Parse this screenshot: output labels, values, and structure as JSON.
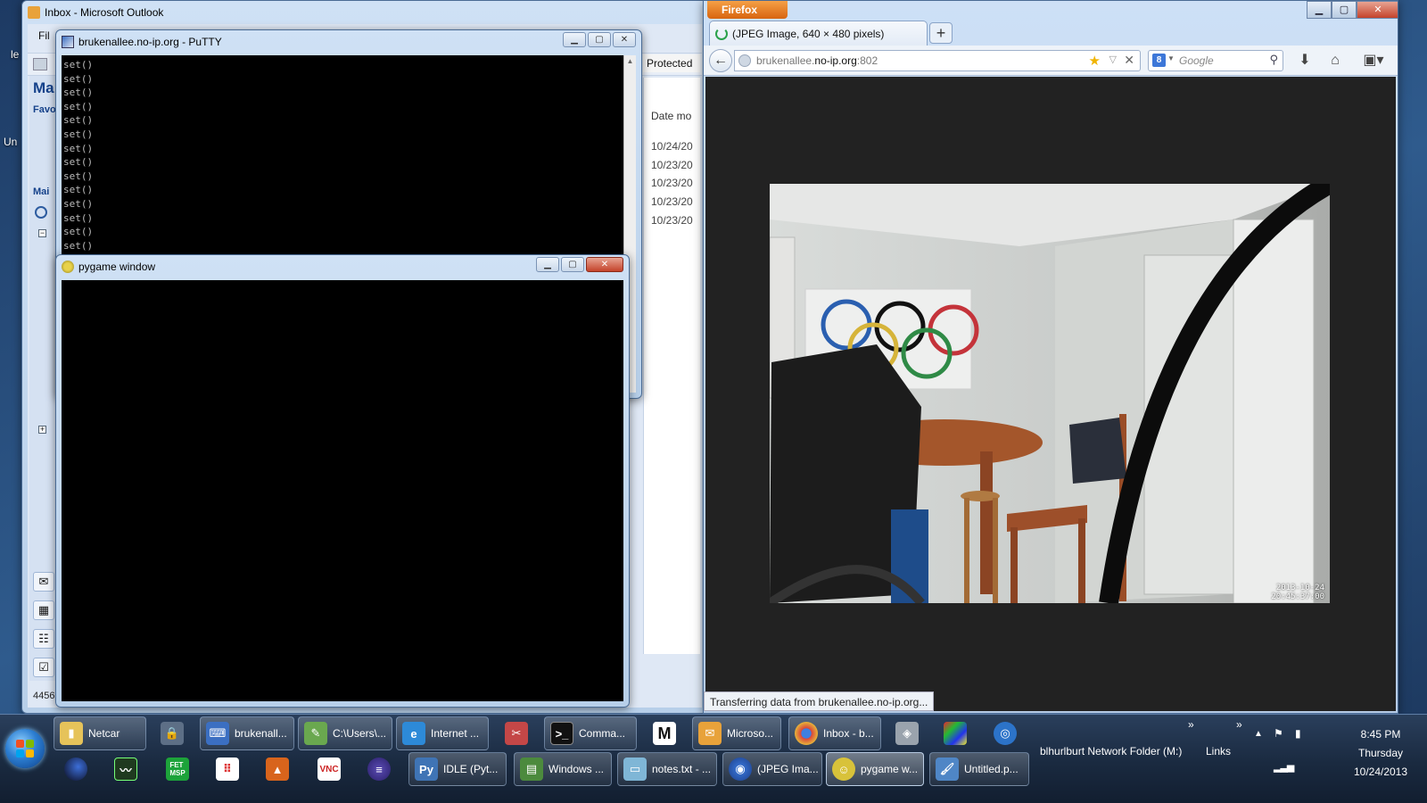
{
  "desktop": {
    "label_left_1": "le",
    "label_left_2": "Un"
  },
  "outlook": {
    "title": "Inbox - Microsoft Outlook",
    "menu_file": "Fil",
    "nav_title": "Ma",
    "favorites_label": "Favo",
    "mail_label": "Mai",
    "protected_label": "Protected",
    "date_header": "Date mo",
    "dates": [
      "10/24/20",
      "10/23/20",
      "10/23/20",
      "10/23/20",
      "10/23/20"
    ],
    "status": "4456 I"
  },
  "putty": {
    "title": "brukenallee.no-ip.org - PuTTY",
    "lines": [
      "set()",
      "set()",
      "set()",
      "set()",
      "set()",
      "set()",
      "set()",
      "set()",
      "set()",
      "set()",
      "set()",
      "set()",
      "set()",
      "set()"
    ]
  },
  "pygame": {
    "title": "pygame window"
  },
  "firefox": {
    "app_button": "Firefox",
    "tab_title": "(JPEG Image, 640 × 480 pixels)",
    "url_host": "brukenallee.",
    "url_domain": "no-ip.org",
    "url_port": ":802",
    "search_placeholder": "Google",
    "status_text": "Transferring data from brukenallee.no-ip.org...",
    "image_timestamp_date": "2013-10-24",
    "image_timestamp_time": "20:45:37:00"
  },
  "taskbar": {
    "row1": [
      {
        "label": "Netcar",
        "icon": "folder-icon",
        "color": "#e6c35a"
      },
      {
        "label": "brukenall...",
        "icon": "putty-icon",
        "color": "#3b6fc2"
      },
      {
        "label": "C:\\Users\\...",
        "icon": "notepad-chart-icon",
        "color": "#6aa84f"
      },
      {
        "label": "Internet ...",
        "icon": "internet-explorer-icon",
        "color": "#2d8ad8"
      },
      {
        "label": "Comma...",
        "icon": "command-prompt-icon",
        "color": "#111111"
      },
      {
        "label": "Microso...",
        "icon": "outlook-icon",
        "color": "#e8a23a"
      },
      {
        "label": "Inbox - b...",
        "icon": "chrome-icon",
        "color": "#d9453b"
      }
    ],
    "row2": [
      {
        "label": "IDLE (Pyt...",
        "icon": "python-icon",
        "color": "#3f74b5"
      },
      {
        "label": "Windows ...",
        "icon": "windows-monitor-icon",
        "color": "#4c8a3d"
      },
      {
        "label": "notes.txt - ...",
        "icon": "notepad-icon",
        "color": "#7fb6d6"
      },
      {
        "label": "(JPEG Ima...",
        "icon": "firefox-icon",
        "color": "#1d5fb3"
      },
      {
        "label": "pygame w...",
        "icon": "pygame-icon",
        "color": "#d8c23a"
      },
      {
        "label": "Untitled.p...",
        "icon": "paint-icon",
        "color": "#4f86c6"
      }
    ],
    "network_folder": "blhurlburt Network Folder (M:)",
    "links": "Links",
    "chevron_1": "»",
    "chevron_2": "»",
    "clock_time": "8:45 PM",
    "clock_day": "Thursday",
    "clock_date": "10/24/2013"
  }
}
